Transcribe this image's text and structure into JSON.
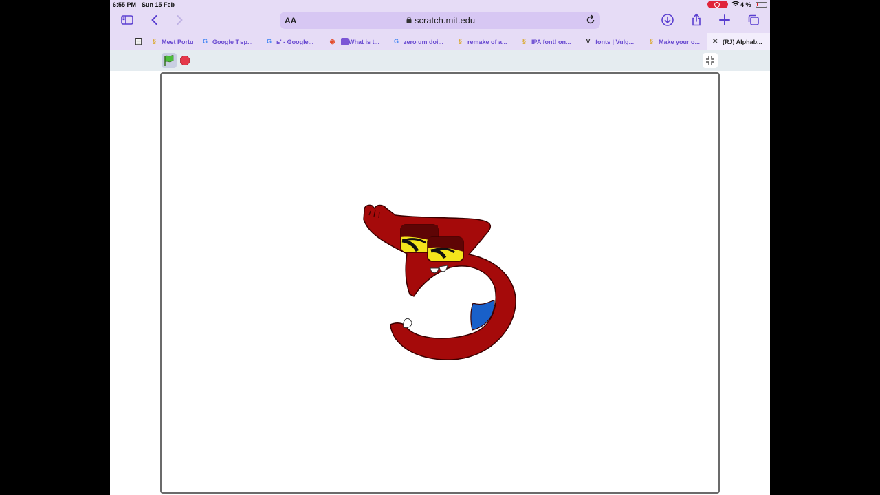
{
  "status": {
    "time": "6:55 PM",
    "date": "Sun 15 Feb",
    "battery": "4 %"
  },
  "address": {
    "aa": "AA",
    "url": "scratch.mit.edu"
  },
  "tabs": [
    {
      "label": "Meet Portu",
      "icon": "scratch-favicon"
    },
    {
      "label": "Google Tър...",
      "icon": "google-favicon"
    },
    {
      "label": "ь' - Google...",
      "icon": "google-favicon"
    },
    {
      "label": "What is t...",
      "icon": "purple-favicon"
    },
    {
      "label": "zero um doi...",
      "icon": "google-favicon"
    },
    {
      "label": "remake of a...",
      "icon": "scratch-favicon"
    },
    {
      "label": "IPA font! on...",
      "icon": "scratch-favicon"
    },
    {
      "label": "fonts | Vulg...",
      "icon": "v-favicon"
    },
    {
      "label": "Make your o...",
      "icon": "scratch-favicon"
    },
    {
      "label": "(RJ) Alphab...",
      "icon": "close-icon"
    }
  ],
  "colors": {
    "chrome": "#e6dcf6",
    "accent": "#5a3fd0",
    "character": "#a50a0a"
  }
}
